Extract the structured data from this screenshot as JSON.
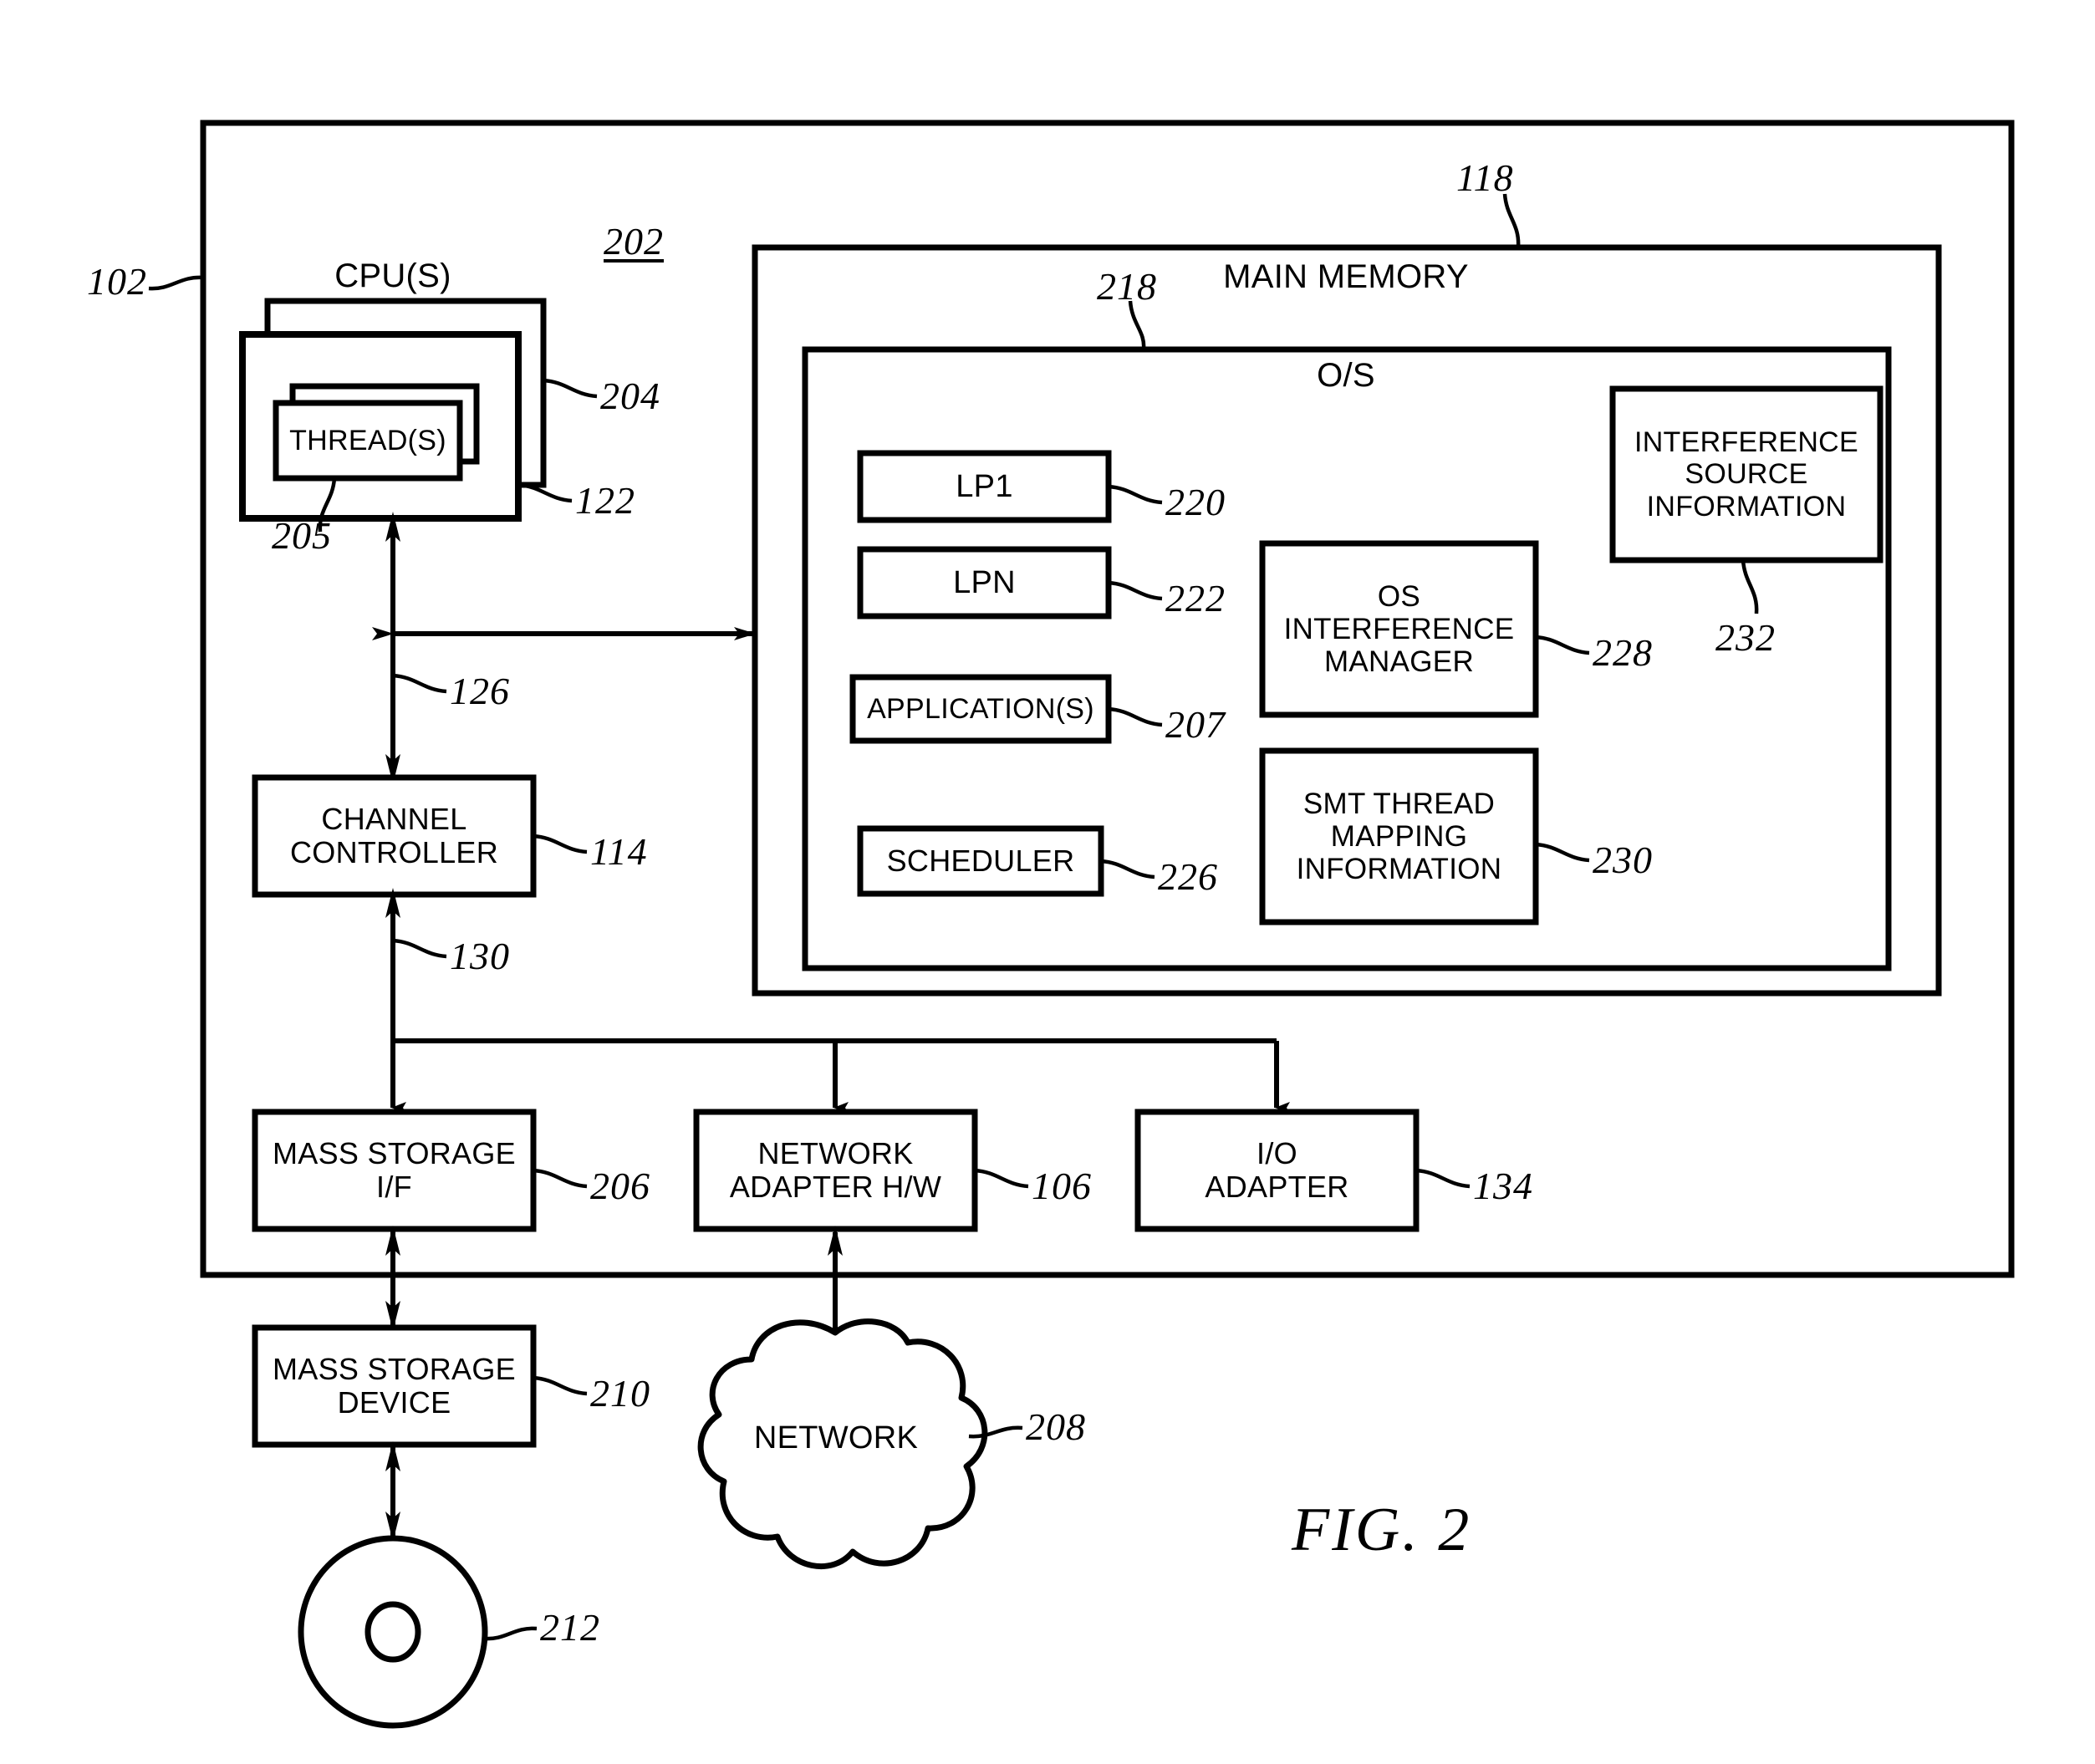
{
  "figure": {
    "caption": "FIG. 2",
    "ref_102": "102",
    "ref_202": "202",
    "ref_204": "204",
    "ref_122": "122",
    "ref_205": "205",
    "ref_126": "126",
    "ref_114": "114",
    "ref_130": "130",
    "ref_118": "118",
    "ref_218": "218",
    "ref_220": "220",
    "ref_222": "222",
    "ref_207": "207",
    "ref_226": "226",
    "ref_228": "228",
    "ref_230": "230",
    "ref_232": "232",
    "ref_206": "206",
    "ref_106": "106",
    "ref_134": "134",
    "ref_210": "210",
    "ref_208": "208",
    "ref_212": "212"
  },
  "computer": {
    "cpu_title": "CPU(S)",
    "thread_box": "THREAD(S)",
    "channel_controller": "CHANNEL\nCONTROLLER",
    "mass_storage_if": "MASS STORAGE\nI/F",
    "network_adapter": "NETWORK\nADAPTER H/W",
    "io_adapter": "I/O\nADAPTER"
  },
  "memory": {
    "title": "MAIN MEMORY",
    "os_title": "O/S",
    "lp1": "LP1",
    "lpn": "LPN",
    "applications": "APPLICATION(S)",
    "scheduler": "SCHEDULER",
    "os_interference_manager": "OS\nINTERFERENCE\nMANAGER",
    "smt_thread_mapping": "SMT THREAD\nMAPPING\nINFORMATION",
    "interference_source_info": "INTERFERENCE\nSOURCE\nINFORMATION"
  },
  "external": {
    "mass_storage_device": "MASS STORAGE\nDEVICE",
    "network_cloud": "NETWORK"
  },
  "colors": {
    "line": "#000000",
    "background": "#ffffff"
  }
}
